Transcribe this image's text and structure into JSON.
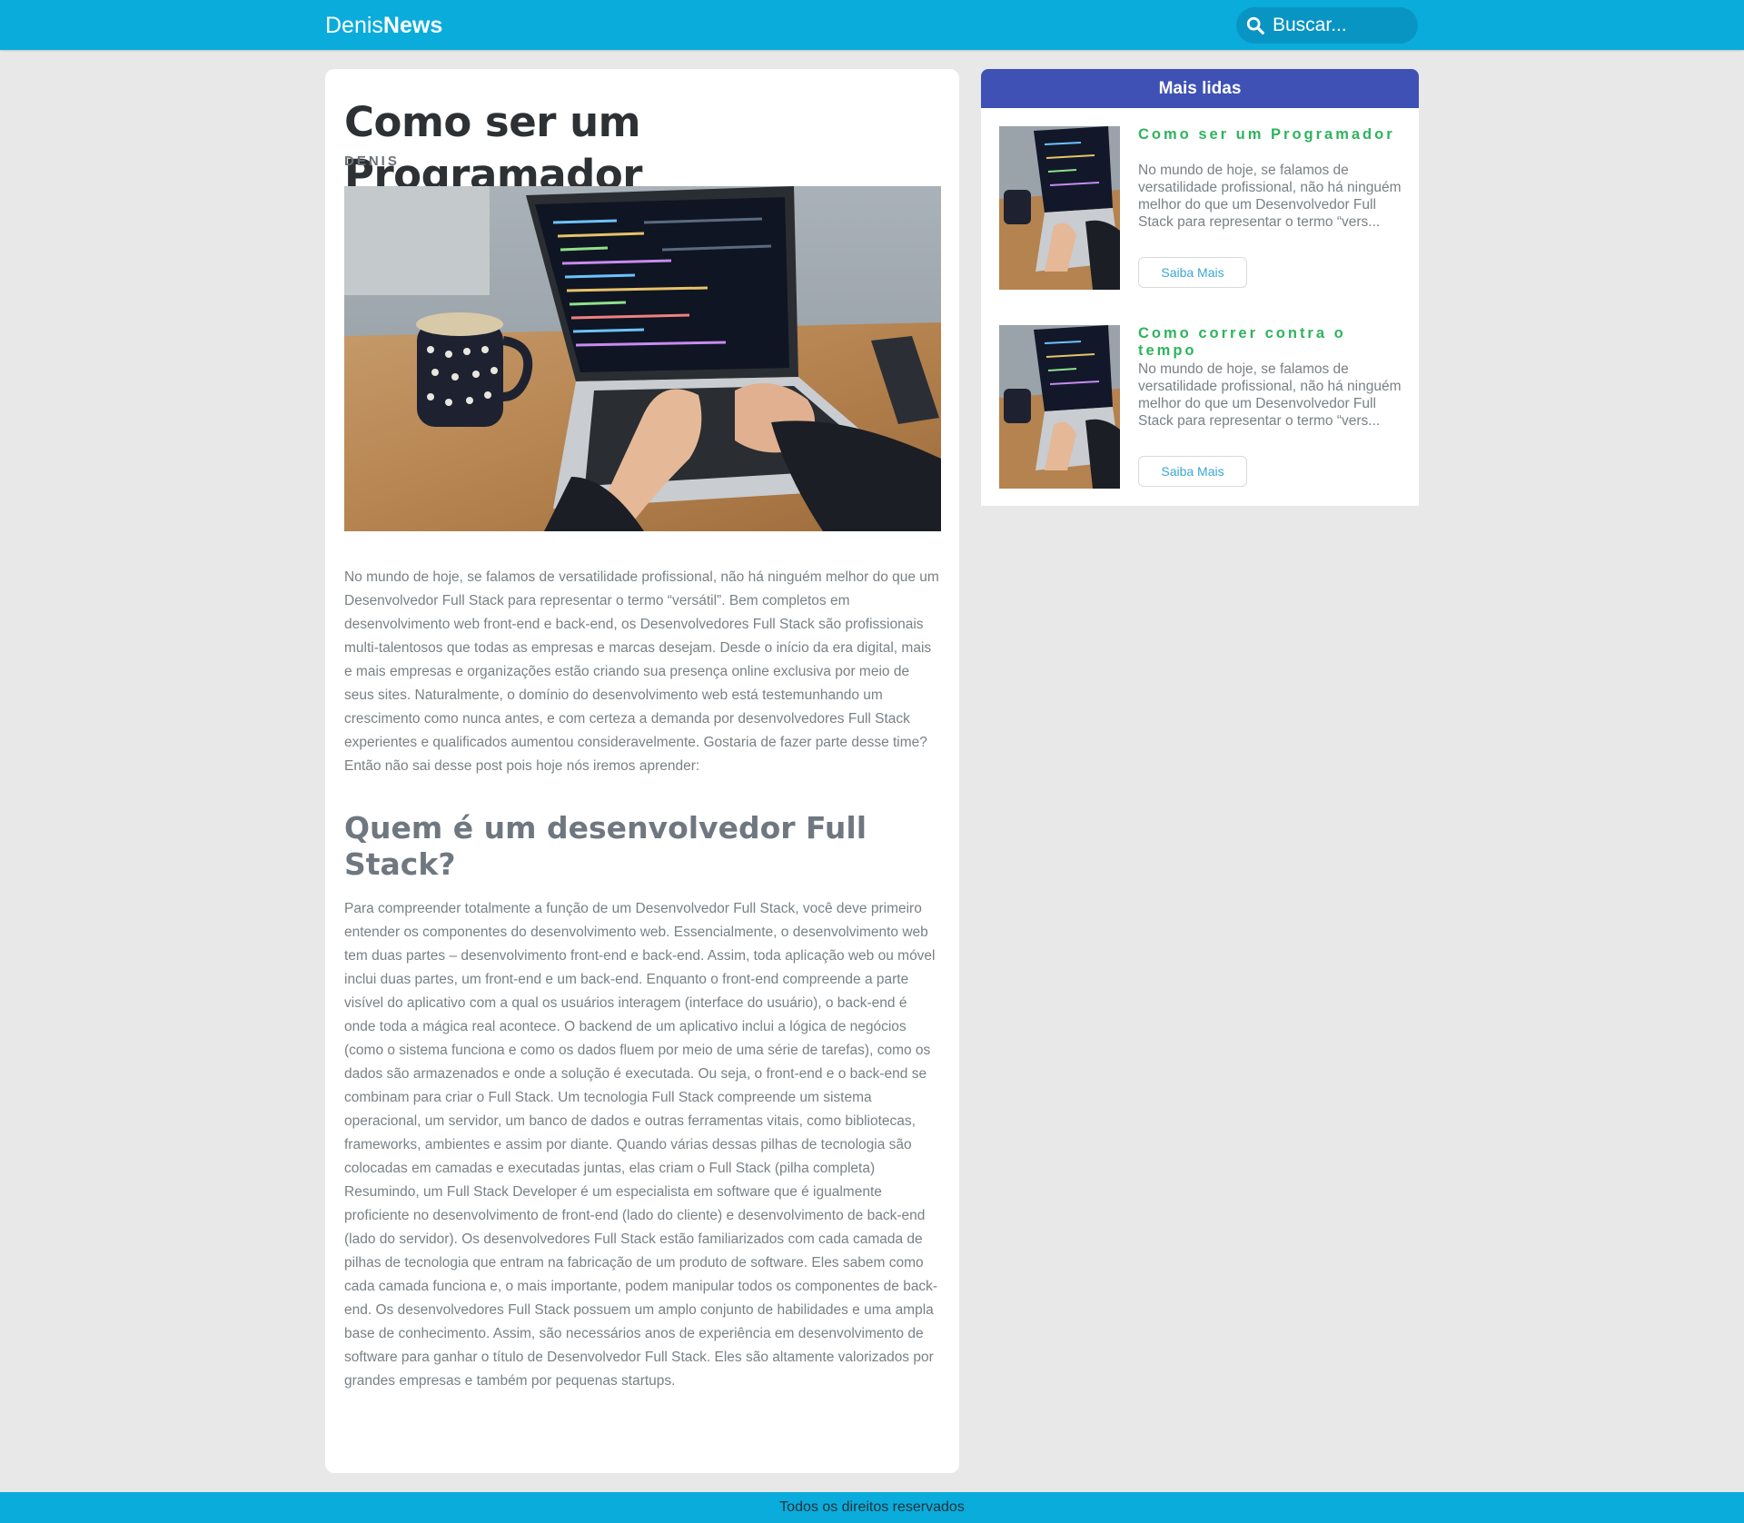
{
  "header": {
    "logo_light": "Denis",
    "logo_bold": "News",
    "search_placeholder": "Buscar...",
    "search_icon": "search-icon",
    "bar_color": "#0aacdc"
  },
  "post": {
    "title": "Como ser um Programador",
    "author": "DENIS",
    "image": "laptop-coding-photo",
    "paragraph_1": "No mundo de hoje, se falamos de versatilidade profissional, não há ninguém melhor do que um Desenvolvedor Full Stack para representar o termo “versátil”. Bem completos em desenvolvimento web front-end e back-end, os Desenvolvedores Full Stack são profissionais multi-talentosos que todas as empresas e marcas desejam. Desde o início da era digital, mais e mais empresas e organizações estão criando sua presença online exclusiva por meio de seus sites. Naturalmente, o domínio do desenvolvimento web está testemunhando um crescimento como nunca antes, e com certeza a demanda por desenvolvedores Full Stack experientes e qualificados aumentou consideravelmente. Gostaria de fazer parte desse time? Então não sai desse post pois hoje nós iremos aprender:",
    "subheading": "Quem é um desenvolvedor Full Stack?",
    "paragraph_2": "Para compreender totalmente a função de um Desenvolvedor Full Stack, você deve primeiro entender os componentes do desenvolvimento web. Essencialmente, o desenvolvimento web tem duas partes – desenvolvimento front-end e back-end. Assim, toda aplicação web ou móvel inclui duas partes, um front-end e um back-end. Enquanto o front-end compreende a parte visível do aplicativo com a qual os usuários interagem (interface do usuário), o back-end é onde toda a mágica real acontece. O backend de um aplicativo inclui a lógica de negócios (como o sistema funciona e como os dados fluem por meio de uma série de tarefas), como os dados são armazenados e onde a solução é executada. Ou seja, o front-end e o back-end se combinam para criar o Full Stack. Um tecnologia Full Stack compreende um sistema operacional, um servidor, um banco de dados e outras ferramentas vitais, como bibliotecas, frameworks, ambientes e assim por diante. Quando várias dessas pilhas de tecnologia são colocadas em camadas e executadas juntas, elas criam o Full Stack (pilha completa) Resumindo, um Full Stack Developer é um especialista em software que é igualmente proficiente no desenvolvimento de front-end (lado do cliente) e desenvolvimento de back-end (lado do servidor). Os desenvolvedores Full Stack estão familiarizados com cada camada de pilhas de tecnologia que entram na fabricação de um produto de software. Eles sabem como cada camada funciona e, o mais importante, podem manipular todos os componentes de back-end. Os desenvolvedores Full Stack possuem um amplo conjunto de habilidades e uma ampla base de conhecimento. Assim, são necessários anos de experiência em desenvolvimento de software para ganhar o título de Desenvolvedor Full Stack. Eles são altamente valorizados por grandes empresas e também por pequenas startups."
  },
  "sidebar": {
    "heading": "Mais lidas",
    "heading_color": "#3f51b5",
    "items": [
      {
        "title": "Como ser um Programador",
        "excerpt": "No mundo de hoje, se falamos de versatilidade profissional, não há ninguém melhor do que um Desenvolvedor Full Stack para representar o termo “vers...",
        "button": "Saiba Mais",
        "image": "laptop-coding-thumbnail"
      },
      {
        "title": "Como correr contra o tempo",
        "excerpt": "No mundo de hoje, se falamos de versatilidade profissional, não há ninguém melhor do que um Desenvolvedor Full Stack para representar o termo “vers...",
        "button": "Saiba Mais",
        "image": "laptop-coding-thumbnail"
      }
    ],
    "title_color": "#2fb35d"
  },
  "footer": {
    "text": "Todos os direitos reservados"
  }
}
